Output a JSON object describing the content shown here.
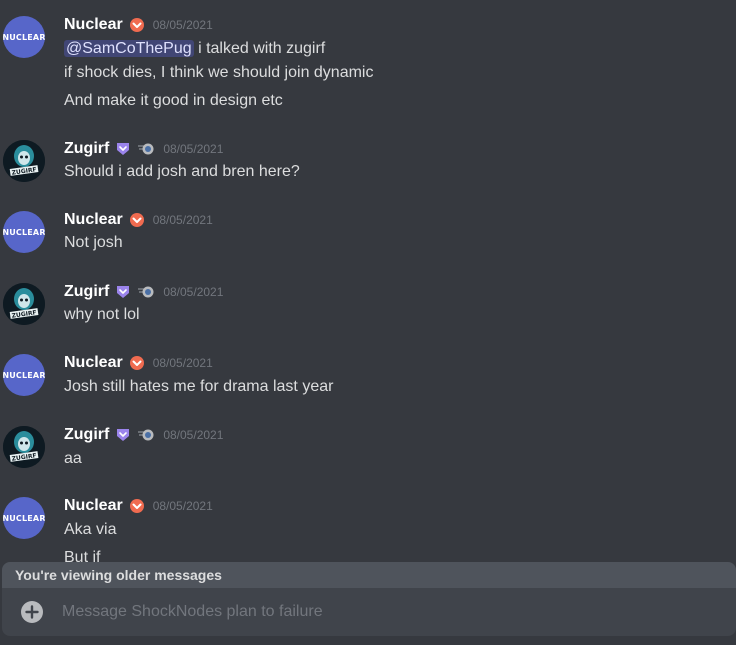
{
  "colors": {
    "background": "#36393f",
    "nuclear_avatar": "#5766c9",
    "nuclear_badge": "#f06b50",
    "zugirf_badge": "#9b84ec",
    "mention_bg": "#414675",
    "older_bar": "#4f545c",
    "composer": "#40444b"
  },
  "messages": [
    {
      "author": "Nuclear",
      "avatar_text": "NUCLEAR",
      "badge_icon": "chevron-down-badge-icon",
      "timestamp": "08/05/2021",
      "mention": "@SamCoThePug",
      "lines": [
        " i talked with zugirf",
        "if shock dies, I think we should join dynamic",
        "And make it good in design etc"
      ]
    },
    {
      "author": "Zugirf",
      "avatar_text": "ZUGIRF",
      "badge_icon": "shield-badge-icon",
      "status_icon": "status-orb-icon",
      "timestamp": "08/05/2021",
      "lines": [
        "Should i add josh and bren here?"
      ]
    },
    {
      "author": "Nuclear",
      "avatar_text": "NUCLEAR",
      "timestamp": "08/05/2021",
      "lines": [
        "Not josh"
      ]
    },
    {
      "author": "Zugirf",
      "avatar_text": "ZUGIRF",
      "timestamp": "08/05/2021",
      "lines": [
        "why not lol"
      ]
    },
    {
      "author": "Nuclear",
      "avatar_text": "NUCLEAR",
      "timestamp": "08/05/2021",
      "lines": [
        "Josh still hates me for drama last year"
      ]
    },
    {
      "author": "Zugirf",
      "avatar_text": "ZUGIRF",
      "timestamp": "08/05/2021",
      "lines": [
        "aa"
      ]
    },
    {
      "author": "Nuclear",
      "avatar_text": "NUCLEAR",
      "timestamp": "08/05/2021",
      "lines": [
        "Aka via",
        "But if"
      ]
    }
  ],
  "older_notice": "You're viewing older messages",
  "composer": {
    "placeholder": "Message ShockNodes plan to failure"
  }
}
